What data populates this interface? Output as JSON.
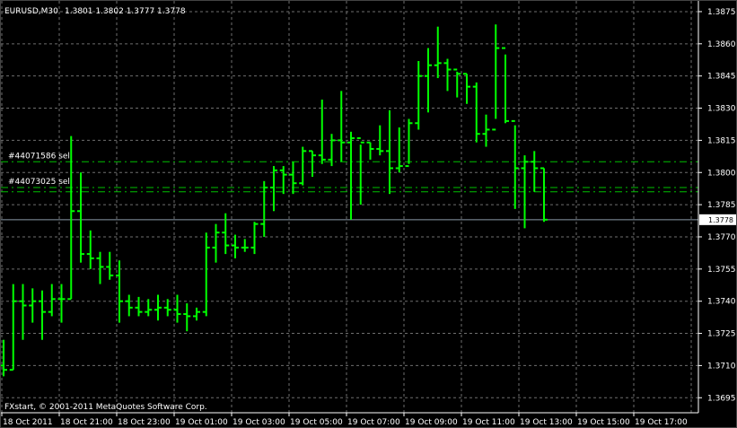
{
  "chart_data": {
    "type": "ohlc",
    "symbol_header": "EURUSD,M30",
    "header_values": "1.3801 1.3802 1.3777 1.3778",
    "copyright": "FXstart, © 2001-2011 MetaQuotes Software Corp.",
    "current_price_label": "1.3778",
    "current_price": 1.3778,
    "ylim": [
      1.3688,
      1.388
    ],
    "y_ticks": [
      "1.3875",
      "1.3860",
      "1.3845",
      "1.3830",
      "1.3815",
      "1.3800",
      "1.3785",
      "1.3770",
      "1.3755",
      "1.3740",
      "1.3725",
      "1.3710",
      "1.3695"
    ],
    "x_ticks": [
      "18 Oct 2011",
      "18 Oct 21:00",
      "18 Oct 23:00",
      "19 Oct 01:00",
      "19 Oct 03:00",
      "19 Oct 05:00",
      "19 Oct 07:00",
      "19 Oct 09:00",
      "19 Oct 11:00",
      "19 Oct 13:00",
      "19 Oct 15:00",
      "19 Oct 17:00"
    ],
    "grid": true,
    "colors": {
      "background": "#000000",
      "bars": "#00ff00",
      "grid": "#6e6e6e",
      "axis": "#ffffff",
      "text": "#ffffff",
      "order_line": "#00c000",
      "current_price_line": "#8a9aa8"
    },
    "orders": [
      {
        "label": "#44071586 sell",
        "price": 1.3805
      },
      {
        "label": "#44073025 sell",
        "price": 1.3793
      }
    ],
    "extra_order_levels": [
      1.3791
    ],
    "bars": [
      {
        "o": 1.371,
        "h": 1.3722,
        "l": 1.3705,
        "c": 1.3708
      },
      {
        "o": 1.3708,
        "h": 1.3748,
        "l": 1.3708,
        "c": 1.374
      },
      {
        "o": 1.374,
        "h": 1.3748,
        "l": 1.3722,
        "c": 1.3738
      },
      {
        "o": 1.3738,
        "h": 1.3746,
        "l": 1.373,
        "c": 1.374
      },
      {
        "o": 1.374,
        "h": 1.3745,
        "l": 1.3722,
        "c": 1.3735
      },
      {
        "o": 1.3735,
        "h": 1.3748,
        "l": 1.3733,
        "c": 1.3741
      },
      {
        "o": 1.3741,
        "h": 1.3748,
        "l": 1.373,
        "c": 1.3741
      },
      {
        "o": 1.3741,
        "h": 1.3817,
        "l": 1.3741,
        "c": 1.3782
      },
      {
        "o": 1.3782,
        "h": 1.38,
        "l": 1.3758,
        "c": 1.3762
      },
      {
        "o": 1.3762,
        "h": 1.3773,
        "l": 1.3755,
        "c": 1.376
      },
      {
        "o": 1.376,
        "h": 1.3763,
        "l": 1.3748,
        "c": 1.3756
      },
      {
        "o": 1.3756,
        "h": 1.3763,
        "l": 1.375,
        "c": 1.3752
      },
      {
        "o": 1.3752,
        "h": 1.3759,
        "l": 1.373,
        "c": 1.374
      },
      {
        "o": 1.374,
        "h": 1.3743,
        "l": 1.3733,
        "c": 1.3737
      },
      {
        "o": 1.3737,
        "h": 1.3742,
        "l": 1.3733,
        "c": 1.3735
      },
      {
        "o": 1.3735,
        "h": 1.3741,
        "l": 1.3733,
        "c": 1.3736
      },
      {
        "o": 1.3736,
        "h": 1.3743,
        "l": 1.3731,
        "c": 1.3737
      },
      {
        "o": 1.3737,
        "h": 1.3741,
        "l": 1.3733,
        "c": 1.3736
      },
      {
        "o": 1.3736,
        "h": 1.3743,
        "l": 1.373,
        "c": 1.3734
      },
      {
        "o": 1.3734,
        "h": 1.3739,
        "l": 1.3726,
        "c": 1.3733
      },
      {
        "o": 1.3733,
        "h": 1.3737,
        "l": 1.3731,
        "c": 1.3735
      },
      {
        "o": 1.3735,
        "h": 1.3772,
        "l": 1.3733,
        "c": 1.3765
      },
      {
        "o": 1.3765,
        "h": 1.3776,
        "l": 1.3758,
        "c": 1.3772
      },
      {
        "o": 1.3772,
        "h": 1.3781,
        "l": 1.3762,
        "c": 1.3766
      },
      {
        "o": 1.3766,
        "h": 1.3771,
        "l": 1.376,
        "c": 1.3765
      },
      {
        "o": 1.3765,
        "h": 1.3769,
        "l": 1.3763,
        "c": 1.3765
      },
      {
        "o": 1.3765,
        "h": 1.3777,
        "l": 1.3762,
        "c": 1.3776
      },
      {
        "o": 1.3776,
        "h": 1.3796,
        "l": 1.377,
        "c": 1.3793
      },
      {
        "o": 1.3793,
        "h": 1.3803,
        "l": 1.3782,
        "c": 1.3801
      },
      {
        "o": 1.3801,
        "h": 1.3803,
        "l": 1.379,
        "c": 1.3799
      },
      {
        "o": 1.3799,
        "h": 1.3805,
        "l": 1.379,
        "c": 1.3795
      },
      {
        "o": 1.3795,
        "h": 1.3812,
        "l": 1.3794,
        "c": 1.381
      },
      {
        "o": 1.381,
        "h": 1.381,
        "l": 1.3798,
        "c": 1.3808
      },
      {
        "o": 1.3808,
        "h": 1.3834,
        "l": 1.3804,
        "c": 1.3806
      },
      {
        "o": 1.3806,
        "h": 1.3818,
        "l": 1.3803,
        "c": 1.3815
      },
      {
        "o": 1.3815,
        "h": 1.3838,
        "l": 1.3805,
        "c": 1.3814
      },
      {
        "o": 1.3814,
        "h": 1.3819,
        "l": 1.3778,
        "c": 1.3816
      },
      {
        "o": 1.3816,
        "h": 1.3813,
        "l": 1.3785,
        "c": 1.3814
      },
      {
        "o": 1.3814,
        "h": 1.3814,
        "l": 1.3806,
        "c": 1.3811
      },
      {
        "o": 1.3811,
        "h": 1.3822,
        "l": 1.3808,
        "c": 1.381
      },
      {
        "o": 1.381,
        "h": 1.3829,
        "l": 1.379,
        "c": 1.3802
      },
      {
        "o": 1.3802,
        "h": 1.3821,
        "l": 1.38,
        "c": 1.3803
      },
      {
        "o": 1.3803,
        "h": 1.3825,
        "l": 1.3804,
        "c": 1.3823
      },
      {
        "o": 1.3823,
        "h": 1.3852,
        "l": 1.382,
        "c": 1.3845
      },
      {
        "o": 1.3845,
        "h": 1.3858,
        "l": 1.3828,
        "c": 1.385
      },
      {
        "o": 1.385,
        "h": 1.3868,
        "l": 1.3844,
        "c": 1.3851
      },
      {
        "o": 1.3851,
        "h": 1.3853,
        "l": 1.3838,
        "c": 1.3848
      },
      {
        "o": 1.3848,
        "h": 1.3847,
        "l": 1.3835,
        "c": 1.3846
      },
      {
        "o": 1.3846,
        "h": 1.3846,
        "l": 1.3832,
        "c": 1.384
      },
      {
        "o": 1.384,
        "h": 1.3842,
        "l": 1.3814,
        "c": 1.3818
      },
      {
        "o": 1.3818,
        "h": 1.3827,
        "l": 1.3812,
        "c": 1.382
      },
      {
        "o": 1.382,
        "h": 1.3869,
        "l": 1.3825,
        "c": 1.3858
      },
      {
        "o": 1.3858,
        "h": 1.3855,
        "l": 1.3823,
        "c": 1.3824
      },
      {
        "o": 1.3824,
        "h": 1.3822,
        "l": 1.3783,
        "c": 1.3802
      },
      {
        "o": 1.3802,
        "h": 1.3808,
        "l": 1.3774,
        "c": 1.3805
      },
      {
        "o": 1.3805,
        "h": 1.381,
        "l": 1.3791,
        "c": 1.3802
      },
      {
        "o": 1.3802,
        "h": 1.3802,
        "l": 1.3777,
        "c": 1.3778
      }
    ]
  }
}
